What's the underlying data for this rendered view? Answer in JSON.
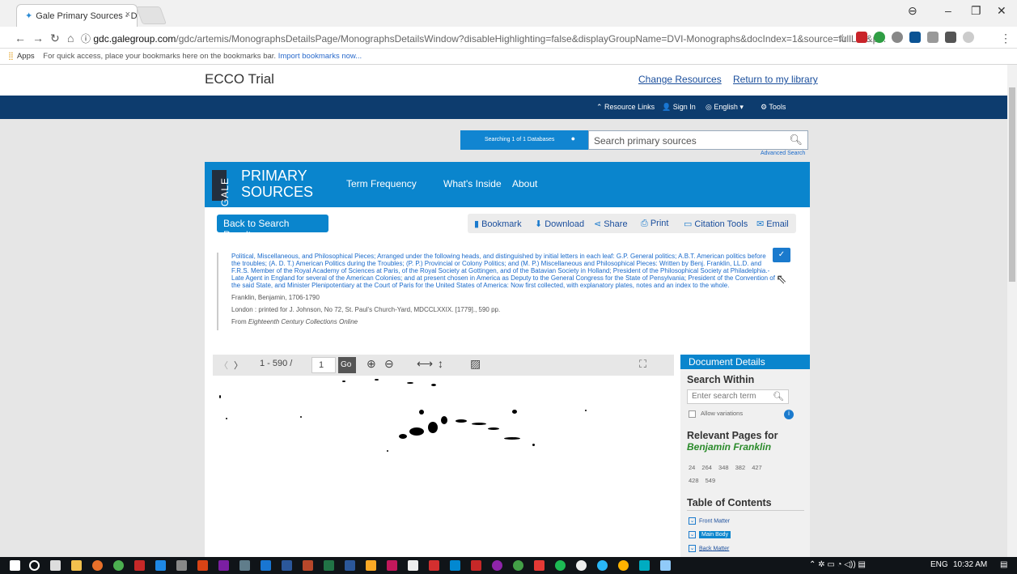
{
  "browser": {
    "tab_title": "Gale Primary Sources - D",
    "url_host": "gdc.galegroup.com",
    "url_path": "/gdc/artemis/MonographsDetailsPage/MonographsDetailsWindow?disableHighlighting=false&displayGroupName=DVI-Monographs&docIndex=1&source=fullList&p...",
    "bookmarks_apps": "Apps",
    "bookmarks_msg": "For quick access, place your bookmarks here on the bookmarks bar.",
    "bookmarks_link": "Import bookmarks now..."
  },
  "header": {
    "site_title": "ECCO Trial",
    "change_resources": "Change Resources",
    "return_library": "Return to my library"
  },
  "navbar": {
    "resource_links": "Resource Links",
    "sign_in": "Sign In",
    "language": "English",
    "tools": "Tools"
  },
  "search": {
    "db_selector": "Searching 1 of 1 Databases",
    "placeholder": "Search primary sources",
    "advanced": "Advanced Search"
  },
  "banner": {
    "gale": "GALE",
    "primary": "PRIMARY",
    "sources": "SOURCES",
    "nav": [
      "Term Frequency",
      "What's Inside",
      "About"
    ]
  },
  "actions": {
    "back": "Back to Search Results",
    "bookmark": "Bookmark",
    "download": "Download",
    "share": "Share",
    "print": "Print",
    "citation": "Citation Tools",
    "email": "Email"
  },
  "document": {
    "title": "Political, Miscellaneous, and Philosophical Pieces; Arranged under the following heads, and distinguished by initial letters in each leaf: G.P. General politics; A.B.T. American politics before the troubles; (A. D. T.) American Politics during the Troubles; (P. P.) Provincial or Colony Politics; and (M. P.) Miscellaneous and Philosophical Pieces: Written by Benj. Franklin, LL.D. and F.R.S. Member of the Royal Academy of Sciences at Paris, of the Royal Society at Gottingen, and of the Batavian Society in Holland; President of the Philosophical Society at Philadelphia.-Late Agent in England for several of the American Colonies; and at present chosen in America as Deputy to the General Congress for the State of Pensylvania; President of the Convention of the said State, and Minister Plenipotentiary at the Court of Paris for the United States of America: Now first collected, with explanatory plates, notes and an index to the whole.",
    "author": "Franklin, Benjamin, 1706-1790",
    "imprint": "London : printed for J. Johnson, No 72, St. Paul's Church-Yard, MDCCLXXIX. [1779]., 590 pp.",
    "from_label": "From",
    "collection": "Eighteenth Century Collections Online"
  },
  "viewer": {
    "page_range": "1 - 590 /",
    "page_value": "1",
    "go": "Go"
  },
  "side": {
    "header": "Document Details",
    "search_within": "Search Within",
    "search_placeholder": "Enter search term",
    "allow_variations": "Allow variations",
    "relevant_pages": "Relevant Pages for",
    "person": "Benjamin Franklin",
    "pages_row1": "24 264 348 382 427",
    "pages_row2": "428 549",
    "toc_title": "Table of Contents",
    "toc": [
      "Front Matter",
      "Main Body",
      "Back Matter"
    ]
  },
  "taskbar": {
    "lang": "ENG",
    "time": "10:32 AM"
  },
  "colors": {
    "gale_blue": "#0a85cd",
    "navbar": "#0d3c6e"
  }
}
